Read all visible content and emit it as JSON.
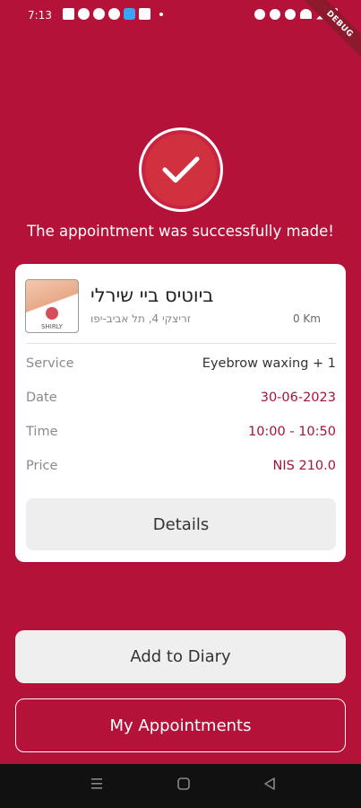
{
  "status_bar": {
    "time": "7:13",
    "debug_label": "DEBUG"
  },
  "success": {
    "message": "The appointment was successfully made!"
  },
  "business": {
    "name": "ביוטיס ביי שירלי",
    "address": "זריצקי 4, תל אביב-יפו",
    "distance": "0 Km",
    "logo_text": "SHIRLY"
  },
  "details": [
    {
      "label": "Service",
      "value": "Eyebrow waxing + 1",
      "color": "#333333"
    },
    {
      "label": "Date",
      "value": "30-06-2023",
      "color": "#a5123a"
    },
    {
      "label": "Time",
      "value": "10:00 - 10:50",
      "color": "#a5123a"
    },
    {
      "label": "Price",
      "value": "NIS 210.0",
      "color": "#a5123a"
    }
  ],
  "buttons": {
    "details": "Details",
    "add_to_diary": "Add to Diary",
    "my_appointments": "My Appointments"
  },
  "nav": {
    "recents_icon": "recents-icon",
    "home_icon": "home-icon",
    "back_icon": "back-icon"
  },
  "colors": {
    "brand": "#b5123a",
    "accent_text": "#a5123a"
  }
}
